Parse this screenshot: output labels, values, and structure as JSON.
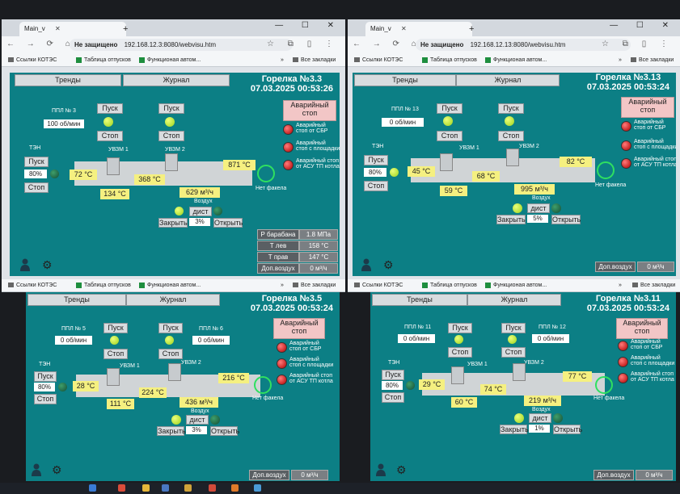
{
  "browser": {
    "tab_title": "Main_v",
    "nav_icons": "← → ⟳ ⌂",
    "not_secure": "Не защищено",
    "new_tab_symbol": "+",
    "window_controls": "— ☐ ✕",
    "right_icons": "☆ ⧉ ▯ ⋮",
    "bookmarks": {
      "item1": "Ссылки КОТЭС",
      "item2": "Таблица отпусков",
      "item3": "Функционая автом...",
      "all": "Все закладки",
      "more": "»"
    }
  },
  "common": {
    "trends": "Тренды",
    "journal": "Журнал",
    "pusk": "Пуск",
    "stop": "Стоп",
    "ten": "ТЭН",
    "ten_pct": "80%",
    "uvzm1": "УВЗМ 1",
    "uvzm2": "УВЗМ 2",
    "air": "Воздух",
    "dist": "дист",
    "close": "Закрыть",
    "open": "Открыть",
    "flame": "Нет факела",
    "alarm_stop_l1": "Аварийный",
    "alarm_stop_l2": "стоп",
    "alarm1_l1": "Аварийный",
    "alarm1_l2": "стоп от СБР",
    "alarm2_l1": "Аварийный",
    "alarm2_l2": "стоп с площадки",
    "alarm3_l1": "Аварийный стоп",
    "alarm3_l2": "от АСУ ТП котла",
    "dop_air": "Доп.воздух",
    "dop_air_val": "0 м³/ч",
    "gear": "⚙"
  },
  "panels": [
    {
      "url": "192.168.12.3:8080/webvisu.htm",
      "title": "Горелка №3.3",
      "datetime": "07.03.2025 00:53:26",
      "ppl_a": "ППЛ № 3",
      "ppl_a_val": "100 об/мин",
      "ppl_b": "",
      "ppl_b_val": "",
      "t1": "72 °C",
      "t2": "134 °C",
      "t3": "368 °C",
      "t4": "871 °C",
      "flow": "629 м³/ч",
      "air_pct": "3%",
      "table": {
        "p_drum": "Р барабана",
        "p_drum_v": "1.8 МПа",
        "t_lev": "Т лев",
        "t_lev_v": "158 °C",
        "t_prav": "Т прав",
        "t_prav_v": "147 °C",
        "dop": "Доп.воздух",
        "dop_v": "0 м³/ч"
      }
    },
    {
      "url": "192.168.12.13:8080/webvisu.htm",
      "title": "Горелка №3.13",
      "datetime": "07.03.2025 00:53:24",
      "ppl_a": "ППЛ № 13",
      "ppl_a_val": "0 об/мин",
      "ppl_b": "",
      "ppl_b_val": "",
      "t1": "45 °C",
      "t2": "59 °C",
      "t3": "68 °C",
      "t4": "82 °C",
      "flow": "995 м³/ч",
      "air_pct": "5%"
    },
    {
      "url": "",
      "title": "Горелка №3.5",
      "datetime": "07.03.2025 00:53:24",
      "ppl_a": "ППЛ № 5",
      "ppl_a_val": "0 об/мин",
      "ppl_b": "ППЛ № 6",
      "ppl_b_val": "0 об/мин",
      "t1": "28 °C",
      "t2": "111 °C",
      "t3": "224 °C",
      "t4": "216 °C",
      "flow": "436 м³/ч",
      "air_pct": "3%"
    },
    {
      "url": "",
      "title": "Горелка №3.11",
      "datetime": "07.03.2025 00:53:24",
      "ppl_a": "ППЛ № 11",
      "ppl_a_val": "0 об/мин",
      "ppl_b": "ППЛ № 12",
      "ppl_b_val": "0 об/мин",
      "t1": "29 °C",
      "t2": "60 °C",
      "t3": "74 °C",
      "t4": "77 °C",
      "flow": "219 м³/ч",
      "air_pct": "1%"
    }
  ]
}
